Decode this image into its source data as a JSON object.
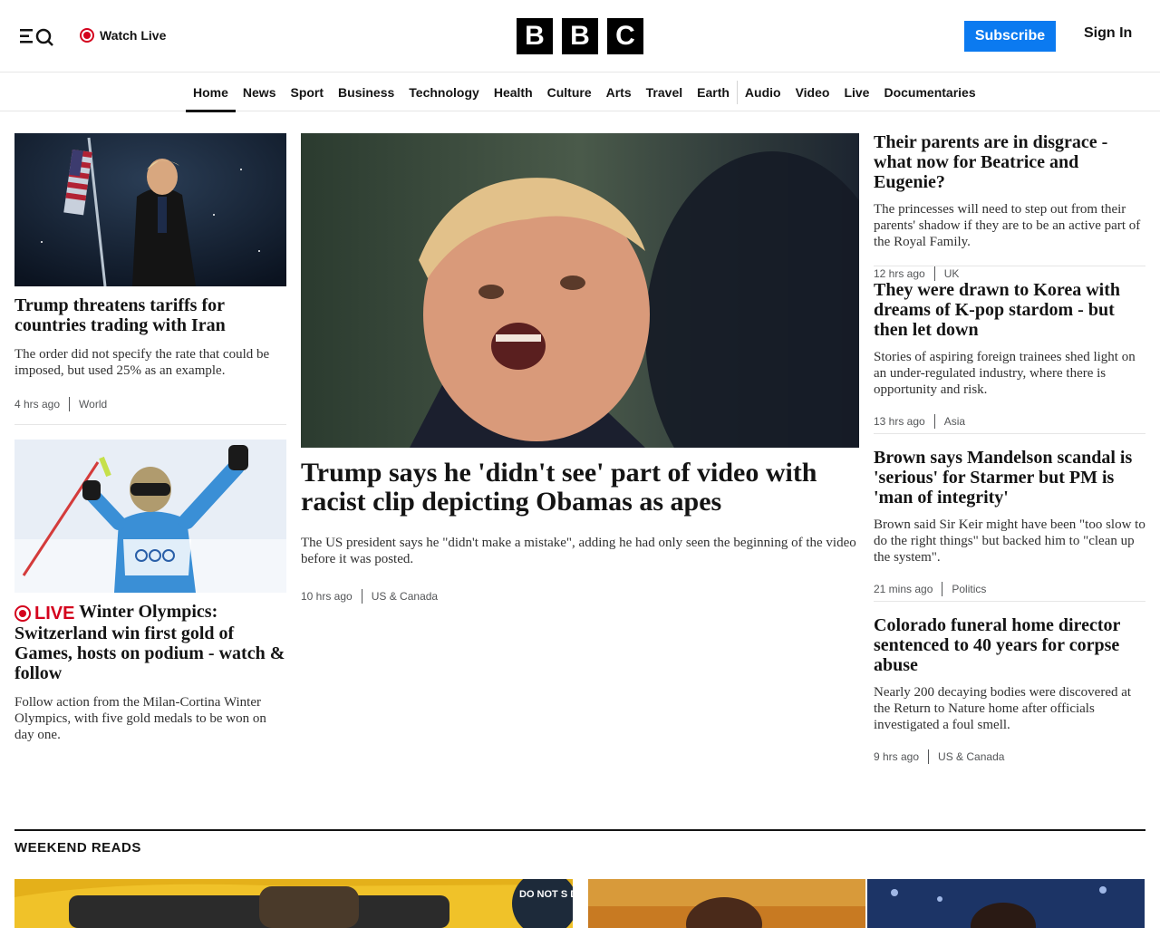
{
  "header": {
    "watch_live": "Watch Live",
    "logo_letters": [
      "B",
      "B",
      "C"
    ],
    "subscribe": "Subscribe",
    "sign_in": "Sign In"
  },
  "nav": {
    "items": [
      "Home",
      "News",
      "Sport",
      "Business",
      "Technology",
      "Health",
      "Culture",
      "Arts",
      "Travel",
      "Earth",
      "Audio",
      "Video",
      "Live",
      "Documentaries"
    ],
    "active": "Home"
  },
  "left": {
    "story1": {
      "headline": "Trump threatens tariffs for countries trading with Iran",
      "summary": "The order did not specify the rate that could be imposed, but used 25% as an example.",
      "time": "4 hrs ago",
      "section": "World"
    },
    "story2": {
      "live_label": "LIVE",
      "headline": "Winter Olympics: Switzerland win first gold of Games, hosts on podium - watch & follow",
      "summary": "Follow action from the Milan-Cortina Winter Olympics, with five gold medals to be won on day one."
    }
  },
  "main": {
    "headline": "Trump says he 'didn't see' part of video with racist clip depicting Obamas as apes",
    "summary": "The US president says he \"didn't make a mistake\", adding he had only seen the beginning of the video before it was posted.",
    "time": "10 hrs ago",
    "section": "US & Canada"
  },
  "right": [
    {
      "headline": "Their parents are in disgrace - what now for Beatrice and Eugenie?",
      "summary": "The princesses will need to step out from their parents' shadow if they are to be an active part of the Royal Family.",
      "time": "12 hrs ago",
      "section": "UK"
    },
    {
      "headline": "They were drawn to Korea with dreams of K-pop stardom - but then let down",
      "summary": "Stories of aspiring foreign trainees shed light on an under-regulated industry, where there is opportunity and risk.",
      "time": "13 hrs ago",
      "section": "Asia"
    },
    {
      "headline": "Brown says Mandelson scandal is 'serious' for Starmer but PM is 'man of integrity'",
      "summary": "Brown said Sir Keir might have been \"too slow to do the right things\" but backed him to \"clean up the system\".",
      "time": "21 mins ago",
      "section": "Politics"
    },
    {
      "headline": "Colorado funeral home director sentenced to 40 years for corpse abuse",
      "summary": "Nearly 200 decaying bodies were discovered at the Return to Nature home after officials investigated a foul smell.",
      "time": "9 hrs ago",
      "section": "US & Canada"
    }
  ],
  "weekend": {
    "title": "WEEKEND READS",
    "sign_text": "DO NOT S DOOR"
  },
  "colors": {
    "subscribe_bg": "#0b7af0",
    "live_red": "#d4021d",
    "text": "#141414"
  }
}
